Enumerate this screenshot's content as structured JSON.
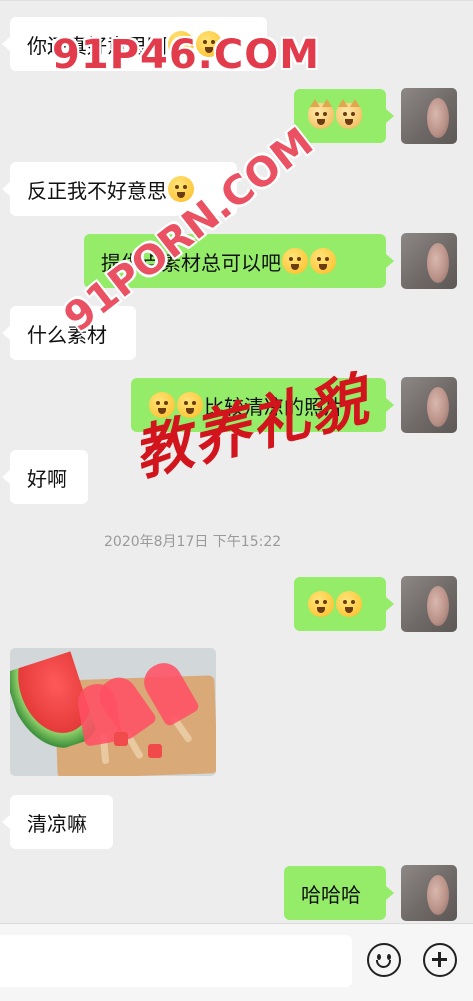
{
  "messages": [
    {
      "side": "in",
      "text": "你还真好意思啊"
    },
    {
      "side": "out",
      "text": ""
    },
    {
      "side": "in",
      "text": "反正我不好意思"
    },
    {
      "side": "out",
      "text": "提供点素材总可以吧"
    },
    {
      "side": "in",
      "text": "什么素材"
    },
    {
      "side": "out",
      "text": "比较清凉的照片"
    },
    {
      "side": "in",
      "text": "好啊"
    },
    {
      "side": "out",
      "text": ""
    },
    {
      "side": "in",
      "text": "清凉嘛"
    },
    {
      "side": "out",
      "text": "哈哈哈"
    }
  ],
  "timestamp": "2020年8月17日 下午15:22",
  "watermarks": {
    "top": "91P46.COM",
    "diagonal": "91PORN.COM",
    "stamp": "教养礼貌"
  },
  "icons": {
    "emoji_button": "smiley-face-icon",
    "more_button": "plus-circle-icon"
  },
  "colors": {
    "background": "#ededed",
    "incoming_bubble": "#ffffff",
    "outgoing_bubble": "#95ec69",
    "watermark_red": "#d2151c"
  }
}
